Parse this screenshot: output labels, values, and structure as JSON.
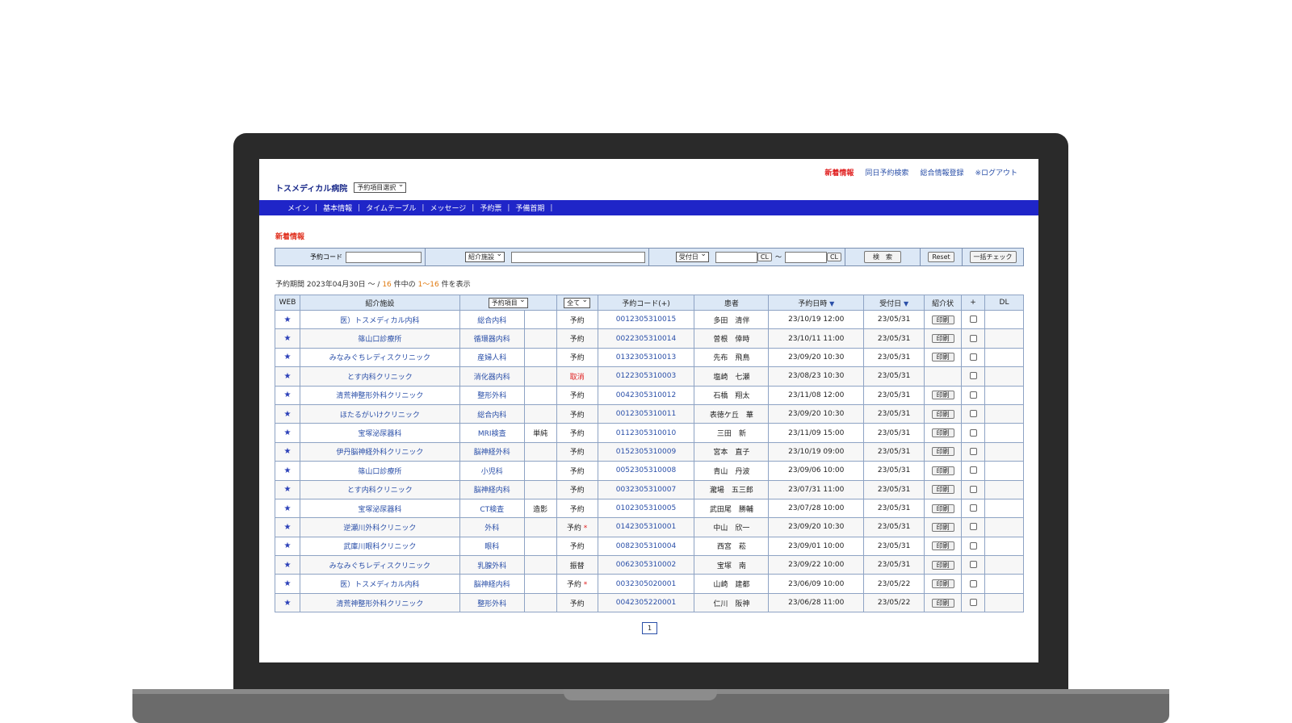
{
  "top_links": {
    "news": "新着情報",
    "same_day_search": "同日予約検索",
    "general_registration": "総合情報登録",
    "logout": "※ログアウト"
  },
  "hospital_name": "トスメディカル病院",
  "item_select": "予約項目選択",
  "nav": [
    "メイン",
    "基本情報",
    "タイムテーブル",
    "メッセージ",
    "予約票",
    "予備首期"
  ],
  "section_title": "新着情報",
  "search": {
    "code_label": "予約コード",
    "facility_select": "紹介施設",
    "date_select": "受付日",
    "cl1": "CL",
    "tilde": "〜",
    "cl2": "CL",
    "search_button": "検　索",
    "reset_button": "Reset",
    "bulk_check_button": "一括チェック"
  },
  "period": {
    "prefix": "予約期間 2023年04月30日 〜 /",
    "count": "16",
    "mid": "件中の",
    "range": "1〜16",
    "suffix": "件を表示"
  },
  "table": {
    "headers": {
      "web": "WEB",
      "facility": "紹介施設",
      "item_select": "予約項目",
      "status_select": "全て",
      "code": "予約コード(+)",
      "patient": "患者",
      "datetime": "予約日時",
      "received": "受付日",
      "letter": "紹介状",
      "plus": "+",
      "dl": "DL"
    },
    "rows": [
      {
        "web": "★",
        "facility": "医）トスメディカル内科",
        "dept": "総合内科",
        "extra": "",
        "status": "予約",
        "mark": "",
        "code": "0012305310015",
        "patient": "多田　清伴",
        "datetime": "23/10/19 12:00",
        "received": "23/05/31",
        "print": "印刷"
      },
      {
        "web": "★",
        "facility": "篠山口診療所",
        "dept": "循環器内科",
        "extra": "",
        "status": "予約",
        "mark": "",
        "code": "0022305310014",
        "patient": "曽根　倖時",
        "datetime": "23/10/11 11:00",
        "received": "23/05/31",
        "print": "印刷"
      },
      {
        "web": "★",
        "facility": "みなみぐちレディスクリニック",
        "dept": "産婦人科",
        "extra": "",
        "status": "予約",
        "mark": "",
        "code": "0132305310013",
        "patient": "先布　飛鳥",
        "datetime": "23/09/20 10:30",
        "received": "23/05/31",
        "print": "印刷"
      },
      {
        "web": "★",
        "facility": "とす内科クリニック",
        "dept": "消化器内科",
        "extra": "",
        "status": "取消",
        "mark": "",
        "code": "0122305310003",
        "patient": "塩崎　七瀬",
        "datetime": "23/08/23 10:30",
        "received": "23/05/31",
        "print": ""
      },
      {
        "web": "★",
        "facility": "清荒神整形外科クリニック",
        "dept": "整形外科",
        "extra": "",
        "status": "予約",
        "mark": "",
        "code": "0042305310012",
        "patient": "石橋　翔太",
        "datetime": "23/11/08 12:00",
        "received": "23/05/31",
        "print": "印刷"
      },
      {
        "web": "★",
        "facility": "ほたるがいけクリニック",
        "dept": "総合内科",
        "extra": "",
        "status": "予約",
        "mark": "",
        "code": "0012305310011",
        "patient": "表徳ケ丘　華",
        "datetime": "23/09/20 10:30",
        "received": "23/05/31",
        "print": "印刷"
      },
      {
        "web": "★",
        "facility": "宝塚泌尿器科",
        "dept": "MRI検査",
        "extra": "単純",
        "status": "予約",
        "mark": "",
        "code": "0112305310010",
        "patient": "三田　新",
        "datetime": "23/11/09 15:00",
        "received": "23/05/31",
        "print": "印刷"
      },
      {
        "web": "★",
        "facility": "伊丹脳神経外科クリニック",
        "dept": "脳神経外科",
        "extra": "",
        "status": "予約",
        "mark": "",
        "code": "0152305310009",
        "patient": "宮本　直子",
        "datetime": "23/10/19 09:00",
        "received": "23/05/31",
        "print": "印刷"
      },
      {
        "web": "★",
        "facility": "篠山口診療所",
        "dept": "小児科",
        "extra": "",
        "status": "予約",
        "mark": "",
        "code": "0052305310008",
        "patient": "青山　丹波",
        "datetime": "23/09/06 10:00",
        "received": "23/05/31",
        "print": "印刷"
      },
      {
        "web": "★",
        "facility": "とす内科クリニック",
        "dept": "脳神経内科",
        "extra": "",
        "status": "予約",
        "mark": "",
        "code": "0032305310007",
        "patient": "瀧場　五三郎",
        "datetime": "23/07/31 11:00",
        "received": "23/05/31",
        "print": "印刷"
      },
      {
        "web": "★",
        "facility": "宝塚泌尿器科",
        "dept": "CT検査",
        "extra": "造影",
        "status": "予約",
        "mark": "",
        "code": "0102305310005",
        "patient": "武田尾　勝輔",
        "datetime": "23/07/28 10:00",
        "received": "23/05/31",
        "print": "印刷"
      },
      {
        "web": "★",
        "facility": "逆瀬川外科クリニック",
        "dept": "外科",
        "extra": "",
        "status": "予約",
        "mark": "*",
        "code": "0142305310001",
        "patient": "中山　欣一",
        "datetime": "23/09/20 10:30",
        "received": "23/05/31",
        "print": "印刷"
      },
      {
        "web": "★",
        "facility": "武庫川眼科クリニック",
        "dept": "眼科",
        "extra": "",
        "status": "予約",
        "mark": "",
        "code": "0082305310004",
        "patient": "西宮　菘",
        "datetime": "23/09/01 10:00",
        "received": "23/05/31",
        "print": "印刷"
      },
      {
        "web": "★",
        "facility": "みなみぐちレディスクリニック",
        "dept": "乳腺外科",
        "extra": "",
        "status": "振替",
        "mark": "",
        "code": "0062305310002",
        "patient": "宝塚　南",
        "datetime": "23/09/22 10:00",
        "received": "23/05/31",
        "print": "印刷"
      },
      {
        "web": "★",
        "facility": "医）トスメディカル内科",
        "dept": "脳神経内科",
        "extra": "",
        "status": "予約",
        "mark": "*",
        "code": "0032305020001",
        "patient": "山崎　建都",
        "datetime": "23/06/09 10:00",
        "received": "23/05/22",
        "print": "印刷"
      },
      {
        "web": "★",
        "facility": "清荒神整形外科クリニック",
        "dept": "整形外科",
        "extra": "",
        "status": "予約",
        "mark": "",
        "code": "0042305220001",
        "patient": "仁川　阪神",
        "datetime": "23/06/28 11:00",
        "received": "23/05/22",
        "print": "印刷"
      }
    ]
  },
  "pager": "1"
}
